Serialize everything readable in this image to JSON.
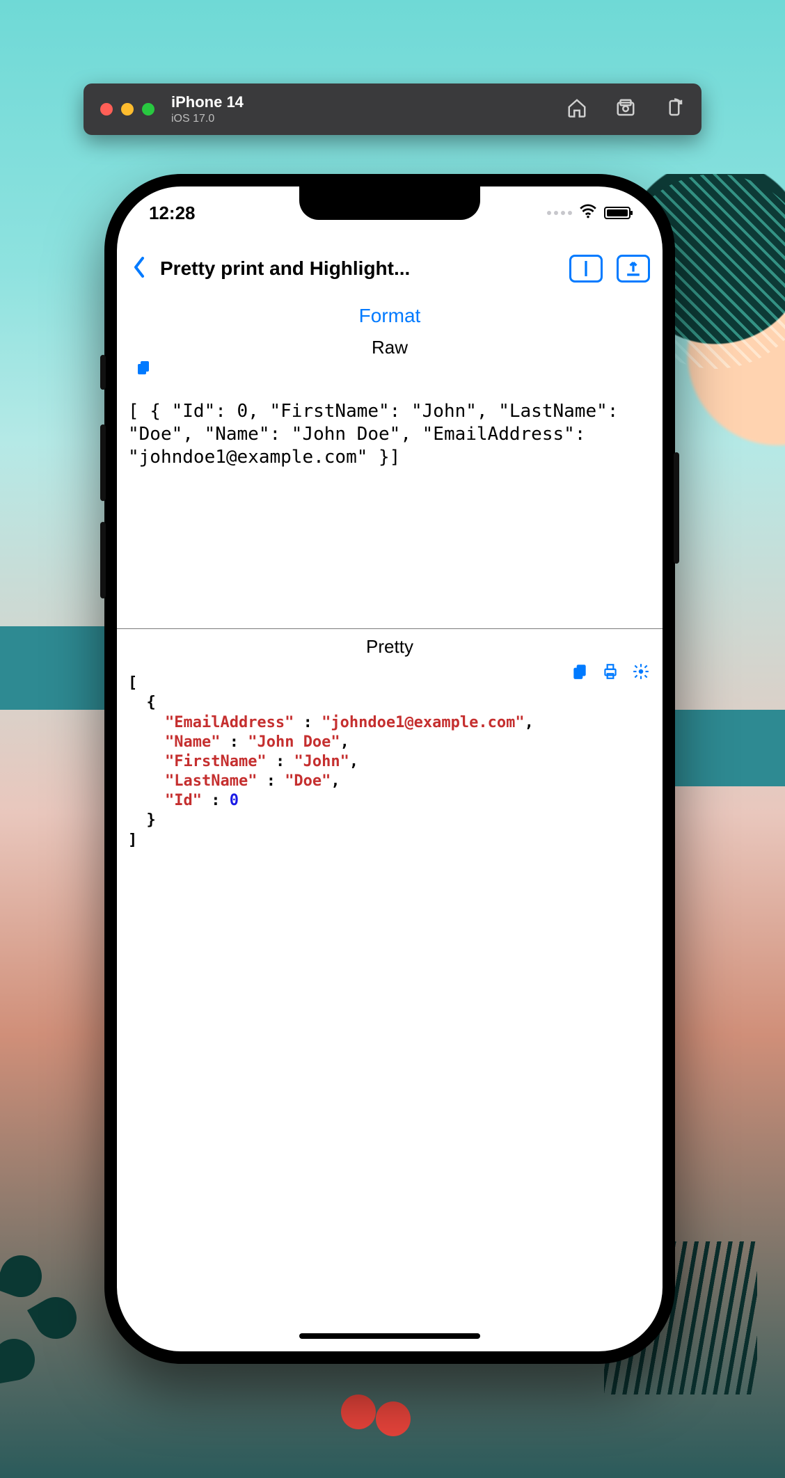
{
  "simulator": {
    "device": "iPhone 14",
    "os": "iOS 17.0",
    "icons": {
      "home": "home-icon",
      "screenshot": "screenshot-icon",
      "rotate": "rotate-icon"
    }
  },
  "status": {
    "time": "12:28"
  },
  "nav": {
    "title": "Pretty print and Highlight...",
    "back": "Back"
  },
  "main": {
    "format_label": "Format",
    "raw_label": "Raw",
    "raw_text": "[ { \"Id\": 0, \"FirstName\": \"John\", \"LastName\": \"Doe\", \"Name\": \"John Doe\", \"EmailAddress\": \"johndoe1@example.com\" }]",
    "pretty_label": "Pretty",
    "pretty_json": [
      {
        "EmailAddress": "johndoe1@example.com",
        "Name": "John Doe",
        "FirstName": "John",
        "LastName": "Doe",
        "Id": 0
      }
    ],
    "pretty_order": [
      "EmailAddress",
      "Name",
      "FirstName",
      "LastName",
      "Id"
    ]
  },
  "colors": {
    "accent": "#007aff",
    "key": "#c52f2f",
    "string": "#c52f2f",
    "number": "#1a1ae6"
  }
}
